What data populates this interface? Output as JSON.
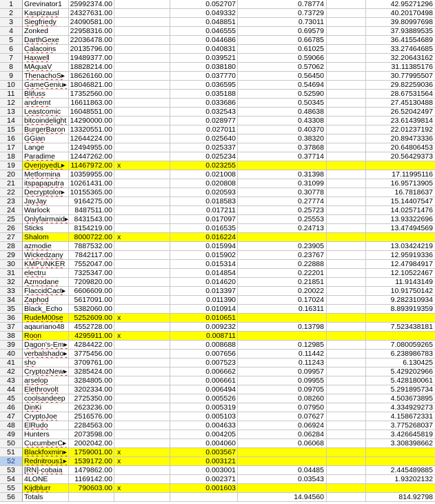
{
  "sheet": {
    "rows": [
      {
        "n": "1",
        "name": "Grevinator1",
        "val": "25992374.00",
        "x": "",
        "d": "0.052707",
        "e": "0.78774",
        "g": "42.95271296",
        "hl": false,
        "spell": false
      },
      {
        "n": "2",
        "name": "Kaspizausl",
        "val": "24327631.00",
        "x": "",
        "d": "0.049332",
        "e": "0.73729",
        "g": "40.20170498",
        "hl": false,
        "spell": true
      },
      {
        "n": "3",
        "name": "Siegfriedy",
        "val": "24090581.00",
        "x": "",
        "d": "0.048851",
        "e": "0.73011",
        "g": "39.80997698",
        "hl": false,
        "spell": true
      },
      {
        "n": "4",
        "name": "Zonked",
        "val": "22958316.00",
        "x": "",
        "d": "0.046555",
        "e": "0.69579",
        "g": "37.93889535",
        "hl": false,
        "spell": false
      },
      {
        "n": "5",
        "name": "DarthGexe",
        "val": "22036478.00",
        "x": "",
        "d": "0.044686",
        "e": "0.66785",
        "g": "36.41554689",
        "hl": false,
        "spell": true
      },
      {
        "n": "6",
        "name": "Calacoins",
        "val": "20135796.00",
        "x": "",
        "d": "0.040831",
        "e": "0.61025",
        "g": "33.27464685",
        "hl": false,
        "spell": true
      },
      {
        "n": "7",
        "name": "Haxwell",
        "val": "19489377.00",
        "x": "",
        "d": "0.039521",
        "e": "0.59066",
        "g": "32.20643162",
        "hl": false,
        "spell": true
      },
      {
        "n": "8",
        "name": "MAquaV",
        "val": "18828214.00",
        "x": "",
        "d": "0.038180",
        "e": "0.57062",
        "g": "31.11385176",
        "hl": false,
        "spell": true
      },
      {
        "n": "9",
        "name": "ThenachoS▸",
        "val": "18626160.00",
        "x": "",
        "d": "0.037770",
        "e": "0.56450",
        "g": "30.77995507",
        "hl": false,
        "spell": true
      },
      {
        "n": "10",
        "name": "GameGeniu▸",
        "val": "18046821.00",
        "x": "",
        "d": "0.036595",
        "e": "0.54694",
        "g": "29.82259036",
        "hl": false,
        "spell": true
      },
      {
        "n": "11",
        "name": "Blifuss",
        "val": "17352560.00",
        "x": "",
        "d": "0.035188",
        "e": "0.52590",
        "g": "28.67531564",
        "hl": false,
        "spell": true
      },
      {
        "n": "12",
        "name": "andremt",
        "val": "16611863.00",
        "x": "",
        "d": "0.033686",
        "e": "0.50345",
        "g": "27.45130488",
        "hl": false,
        "spell": true
      },
      {
        "n": "13",
        "name": "Leastcomic",
        "val": "16048551.00",
        "x": "",
        "d": "0.032543",
        "e": "0.48638",
        "g": "26.52042497",
        "hl": false,
        "spell": true
      },
      {
        "n": "14",
        "name": "bitcoindelight",
        "val": "14290000.00",
        "x": "",
        "d": "0.028977",
        "e": "0.43308",
        "g": "23.61439814",
        "hl": false,
        "spell": true
      },
      {
        "n": "15",
        "name": "BurgerBaron",
        "val": "13320551.00",
        "x": "",
        "d": "0.027011",
        "e": "0.40370",
        "g": "22.01237192",
        "hl": false,
        "spell": true
      },
      {
        "n": "16",
        "name": "GGian",
        "val": "12644224.00",
        "x": "",
        "d": "0.025640",
        "e": "0.38320",
        "g": "20.89473336",
        "hl": false,
        "spell": true
      },
      {
        "n": "17",
        "name": "Lange",
        "val": "12494955.00",
        "x": "",
        "d": "0.025337",
        "e": "0.37868",
        "g": "20.64806453",
        "hl": false,
        "spell": false
      },
      {
        "n": "18",
        "name": "Paradime",
        "val": "12447262.00",
        "x": "",
        "d": "0.025234",
        "e": "0.37714",
        "g": "20.56429373",
        "hl": false,
        "spell": true
      },
      {
        "n": "19",
        "name": "OverjoyedL▸",
        "val": "11467972.00",
        "x": "x",
        "d": "0.023255",
        "e": "",
        "g": "",
        "hl": true,
        "spell": true
      },
      {
        "n": "20",
        "name": "Metformina",
        "val": "10359955.00",
        "x": "",
        "d": "0.021008",
        "e": "0.31398",
        "g": "17.11995116",
        "hl": false,
        "spell": true
      },
      {
        "n": "21",
        "name": "itspapaputra",
        "val": "10261431.00",
        "x": "",
        "d": "0.020808",
        "e": "0.31099",
        "g": "16.95713905",
        "hl": false,
        "spell": true
      },
      {
        "n": "22",
        "name": "Decryptolor▸",
        "val": "10155365.00",
        "x": "",
        "d": "0.020593",
        "e": "0.30778",
        "g": "16.7818637",
        "hl": false,
        "spell": true
      },
      {
        "n": "23",
        "name": "JayJay",
        "val": "9164275.00",
        "x": "",
        "d": "0.018583",
        "e": "0.27774",
        "g": "15.14407547",
        "hl": false,
        "spell": true
      },
      {
        "n": "24",
        "name": "Warlock",
        "val": "8487511.00",
        "x": "",
        "d": "0.017211",
        "e": "0.25723",
        "g": "14.02571476",
        "hl": false,
        "spell": false
      },
      {
        "n": "25",
        "name": "Onlyfairmaid▸",
        "val": "8431543.00",
        "x": "",
        "d": "0.017097",
        "e": "0.25553",
        "g": "13.93322696",
        "hl": false,
        "spell": true
      },
      {
        "n": "26",
        "name": "Sticks",
        "val": "8154219.00",
        "x": "",
        "d": "0.016535",
        "e": "0.24713",
        "g": "13.47494569",
        "hl": false,
        "spell": false
      },
      {
        "n": "27",
        "name": "Shalom",
        "val": "8000722.00",
        "x": "x",
        "d": "0.016224",
        "e": "",
        "g": "",
        "hl": true,
        "spell": false
      },
      {
        "n": "28",
        "name": "azmodie",
        "val": "7887532.00",
        "x": "",
        "d": "0.015994",
        "e": "0.23905",
        "g": "13.03424219",
        "hl": false,
        "spell": true
      },
      {
        "n": "29",
        "name": "Wickedzany",
        "val": "7842117.00",
        "x": "",
        "d": "0.015902",
        "e": "0.23767",
        "g": "12.95919336",
        "hl": false,
        "spell": true
      },
      {
        "n": "30",
        "name": "KMPUNKER",
        "val": "7552047.00",
        "x": "",
        "d": "0.015314",
        "e": "0.22888",
        "g": "12.47984917",
        "hl": false,
        "spell": true
      },
      {
        "n": "31",
        "name": "electru",
        "val": "7325347.00",
        "x": "",
        "d": "0.014854",
        "e": "0.22201",
        "g": "12.10522467",
        "hl": false,
        "spell": true
      },
      {
        "n": "32",
        "name": "Azmodane",
        "val": "7209820.00",
        "x": "",
        "d": "0.014620",
        "e": "0.21851",
        "g": "11.9143149",
        "hl": false,
        "spell": true
      },
      {
        "n": "33",
        "name": "FlaccidCact▸",
        "val": "6606609.00",
        "x": "",
        "d": "0.013397",
        "e": "0.20022",
        "g": "10.91750142",
        "hl": false,
        "spell": true
      },
      {
        "n": "34",
        "name": "Zaphod",
        "val": "5617091.00",
        "x": "",
        "d": "0.011390",
        "e": "0.17024",
        "g": "9.282310934",
        "hl": false,
        "spell": true
      },
      {
        "n": "35",
        "name": "Black_Echo",
        "val": "5382060.00",
        "x": "",
        "d": "0.010914",
        "e": "0.16311",
        "g": "8.893919359",
        "hl": false,
        "spell": false
      },
      {
        "n": "36",
        "name": "RudeM00se",
        "val": "5252609.00",
        "x": "x",
        "d": "0.010651",
        "e": "",
        "g": "",
        "hl": true,
        "spell": true
      },
      {
        "n": "37",
        "name": "aqauriano48",
        "val": "4552728.00",
        "x": "",
        "d": "0.009232",
        "e": "0.13798",
        "g": "7.523438181",
        "hl": false,
        "spell": false
      },
      {
        "n": "38",
        "name": "Roon",
        "val": "4295911.00",
        "x": "x",
        "d": "0.008711",
        "e": "",
        "g": "",
        "hl": true,
        "spell": true
      },
      {
        "n": "39",
        "name": "Dagon's-Em▸",
        "val": "4284422.00",
        "x": "",
        "d": "0.008688",
        "e": "0.12985",
        "g": "7.080059265",
        "hl": false,
        "spell": true
      },
      {
        "n": "40",
        "name": "verbalshado▸",
        "val": "3775456.00",
        "x": "",
        "d": "0.007656",
        "e": "0.11442",
        "g": "6.238986783",
        "hl": false,
        "spell": true
      },
      {
        "n": "41",
        "name": "sho",
        "val": "3709761.00",
        "x": "",
        "d": "0.007523",
        "e": "0.11243",
        "g": "6.130425",
        "hl": false,
        "spell": true
      },
      {
        "n": "42",
        "name": "CryptozNew▸",
        "val": "3285424.00",
        "x": "",
        "d": "0.006662",
        "e": "0.09957",
        "g": "5.429202966",
        "hl": false,
        "spell": true
      },
      {
        "n": "43",
        "name": "arselop",
        "val": "3284805.00",
        "x": "",
        "d": "0.006661",
        "e": "0.09955",
        "g": "5.428180061",
        "hl": false,
        "spell": true
      },
      {
        "n": "44",
        "name": "Elethrovolt",
        "val": "3202334.00",
        "x": "",
        "d": "0.006494",
        "e": "0.09705",
        "g": "5.291895734",
        "hl": false,
        "spell": true
      },
      {
        "n": "45",
        "name": "coolsandeep",
        "val": "2725350.00",
        "x": "",
        "d": "0.005526",
        "e": "0.08260",
        "g": "4.503673895",
        "hl": false,
        "spell": true
      },
      {
        "n": "46",
        "name": "DinKi",
        "val": "2623236.00",
        "x": "",
        "d": "0.005319",
        "e": "0.07950",
        "g": "4.334929273",
        "hl": false,
        "spell": true
      },
      {
        "n": "47",
        "name": "CryptoJoe",
        "val": "2516576.00",
        "x": "",
        "d": "0.005103",
        "e": "0.07627",
        "g": "4.158672331",
        "hl": false,
        "spell": true
      },
      {
        "n": "48",
        "name": "ElRudo",
        "val": "2284563.00",
        "x": "",
        "d": "0.004633",
        "e": "0.06924",
        "g": "3.775268037",
        "hl": false,
        "spell": true
      },
      {
        "n": "49",
        "name": "Hunters",
        "val": "2073598.00",
        "x": "",
        "d": "0.004205",
        "e": "0.06284",
        "g": "3.426645819",
        "hl": false,
        "spell": false
      },
      {
        "n": "50",
        "name": "CucumberC▸",
        "val": "2002042.00",
        "x": "",
        "d": "0.004060",
        "e": "0.06068",
        "g": "3.308398662",
        "hl": false,
        "spell": true
      },
      {
        "n": "51",
        "name": "Blackfoxmin▸",
        "val": "1759001.00",
        "x": "x",
        "d": "0.003567",
        "e": "",
        "g": "",
        "hl": true,
        "spell": true
      },
      {
        "n": "52",
        "name": "Rednitrous1▸",
        "val": "1539172.00",
        "x": "x",
        "d": "0.003121",
        "e": "",
        "g": "",
        "hl": true,
        "spell": true
      },
      {
        "n": "53",
        "name": "[RN]-cobaia",
        "val": "1479862.00",
        "x": "",
        "d": "0.003001",
        "e": "0.04485",
        "g": "2.445489885",
        "hl": false,
        "spell": true
      },
      {
        "n": "54",
        "name": "4LONE",
        "val": "1169142.00",
        "x": "",
        "d": "0.002371",
        "e": "0.03543",
        "g": "1.93202132",
        "hl": false,
        "spell": false
      },
      {
        "n": "55",
        "name": "Kijdblurr",
        "val": "790603.00",
        "x": "x",
        "d": "0.001603",
        "e": "",
        "g": "",
        "hl": true,
        "spell": true
      },
      {
        "n": "56",
        "name": "Totals",
        "val": "",
        "x": "",
        "d": "",
        "e": "14.94560",
        "g": "814.92798",
        "hl": false,
        "spell": false
      }
    ],
    "selected_row": "52"
  }
}
